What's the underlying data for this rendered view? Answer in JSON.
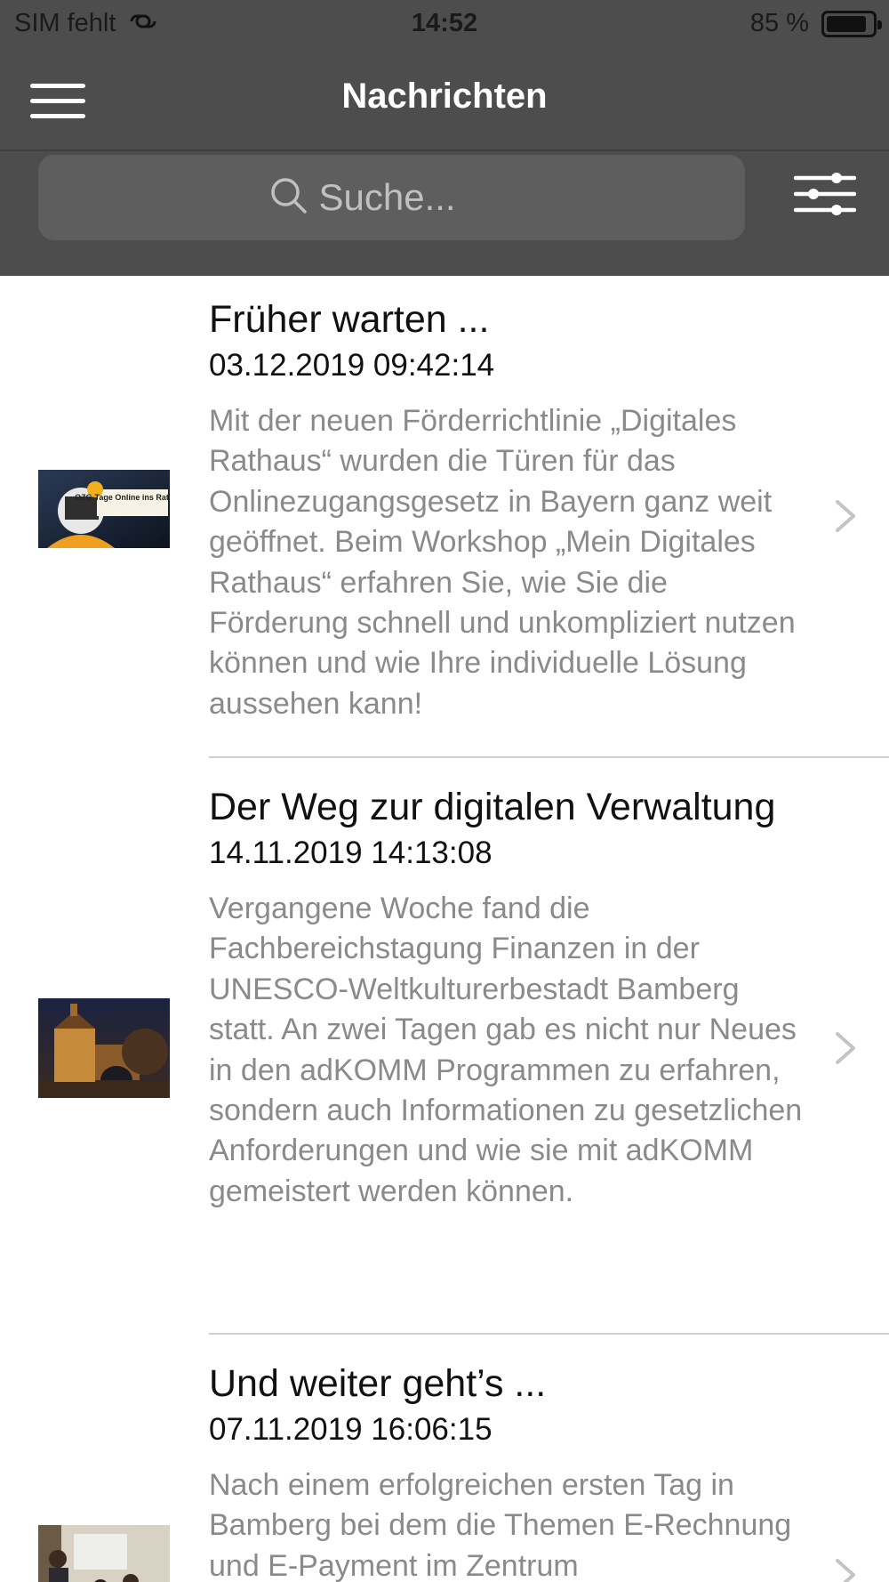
{
  "status_bar": {
    "carrier": "SIM fehlt",
    "time": "14:52",
    "battery": "85 %",
    "battery_level": 0.85
  },
  "nav": {
    "title": "Nachrichten"
  },
  "search": {
    "placeholder": "Suche..."
  },
  "colors": {
    "header_bg": "#4d4d4d",
    "search_bg": "#5e5e5e",
    "title_text": "#ffffff",
    "desc_text": "#8a8a8a",
    "divider": "#cfcfcf"
  },
  "news": [
    {
      "title": "Früher warten ...",
      "date": "03.12.2019 09:42:14",
      "description": "Mit der neuen Förderrichtlinie „Digitales Rathaus“ wurden die Türen für das Onlinezugangsgesetz in Bayern ganz weit geöffnet. Beim Workshop „Mein Digitales Rathaus“ erfahren Sie, wie Sie die Förderung schnell und unkompliziert nutzen können und wie Ihre individuelle Lösung aussehen kann!",
      "thumb_text": "OZG-Tage Online ins Rathaus!"
    },
    {
      "title": "Der Weg zur digitalen Verwaltung",
      "date": "14.11.2019 14:13:08",
      "description": "Vergangene Woche fand die Fachbereichstagung Finanzen in der UNESCO-Weltkulturerbestadt Bamberg statt. An zwei Tagen gab es nicht nur Neues in den adKOMM Programmen zu erfahren, sondern auch Informationen zu gesetzlichen Anforderungen und wie sie mit adKOMM gemeistert werden können."
    },
    {
      "title": "Und weiter geht’s ...",
      "date": "07.11.2019 16:06:15",
      "description": "Nach einem erfolgreichen ersten Tag in Bamberg bei dem die Themen E-Rechnung und E-Payment im Zentrum"
    }
  ]
}
